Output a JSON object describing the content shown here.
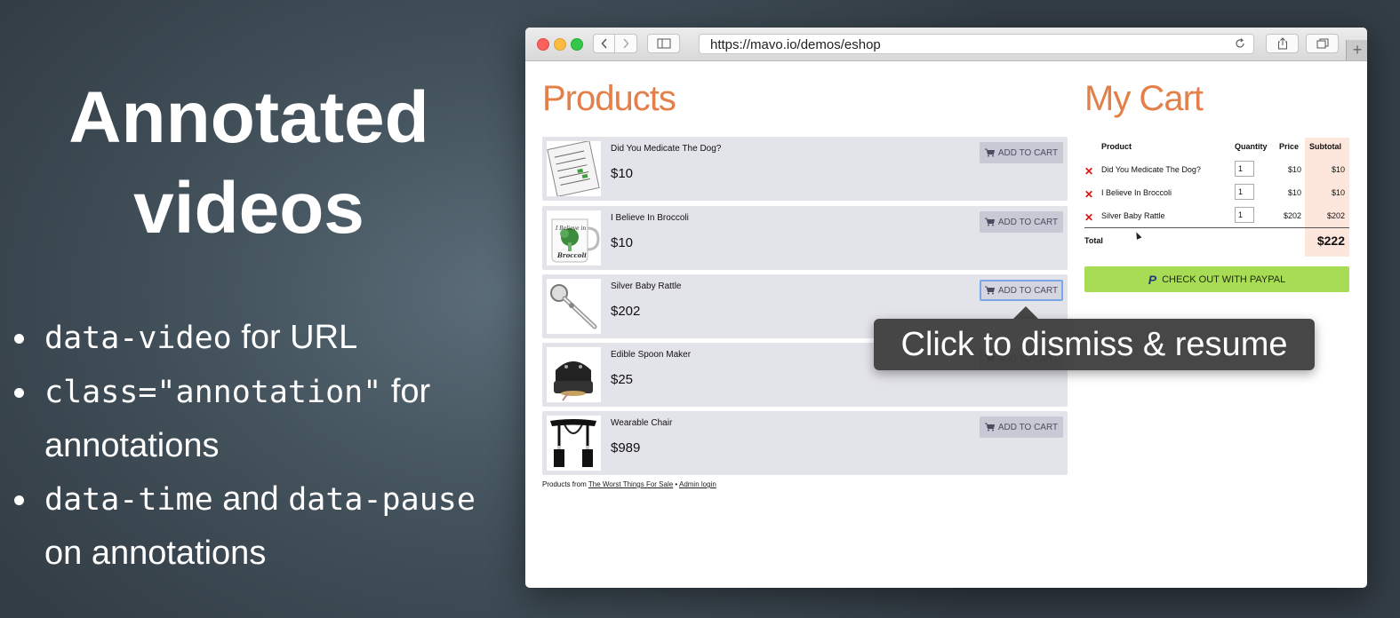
{
  "slide": {
    "title_line1": "Annotated",
    "title_line2": "videos",
    "bullets": [
      {
        "code": "data-video",
        "text": " for URL"
      },
      {
        "code": "class=\"annotation\"",
        "text": " for annotations"
      },
      {
        "code": "data-time",
        "text": " and ",
        "code2": "data-pause",
        "text2": " on annotations"
      }
    ]
  },
  "browser": {
    "url": "https://mavo.io/demos/eshop",
    "back_icon": "chevron-left-icon",
    "forward_icon": "chevron-right-icon",
    "sidebar_icon": "sidebar-icon",
    "reload_icon": "reload-icon",
    "share_icon": "share-icon",
    "tabs_icon": "tabs-icon",
    "new_tab_label": "+"
  },
  "products_heading": "Products",
  "add_to_cart_label": "ADD TO CART",
  "products": [
    {
      "name": "Did You Medicate The Dog?",
      "price": "$10"
    },
    {
      "name": "I Believe In Broccoli",
      "price": "$10"
    },
    {
      "name": "Silver Baby Rattle",
      "price": "$202"
    },
    {
      "name": "Edible Spoon Maker",
      "price": "$25"
    },
    {
      "name": "Wearable Chair",
      "price": "$989"
    }
  ],
  "footer": {
    "prefix": "Products from ",
    "source_link": "The Worst Things For Sale",
    "separator": " • ",
    "admin_link": "Admin login"
  },
  "cart": {
    "heading": "My Cart",
    "columns": {
      "product": "Product",
      "quantity": "Quantity",
      "price": "Price",
      "subtotal": "Subtotal"
    },
    "items": [
      {
        "name": "Did You Medicate The Dog?",
        "quantity": "1",
        "price": "$10",
        "subtotal": "$10"
      },
      {
        "name": "I Believe In Broccoli",
        "quantity": "1",
        "price": "$10",
        "subtotal": "$10"
      },
      {
        "name": "Silver Baby Rattle",
        "quantity": "1",
        "price": "$202",
        "subtotal": "$202"
      }
    ],
    "total_label": "Total",
    "total_value": "$222",
    "checkout_label": "CHECK OUT WITH PAYPAL",
    "remove_symbol": "✕"
  },
  "tooltip": "Click to dismiss & resume",
  "colors": {
    "heading_orange": "#e37f49",
    "paypal_green": "#a8dc55",
    "subtotal_bg": "#fde6dc"
  }
}
